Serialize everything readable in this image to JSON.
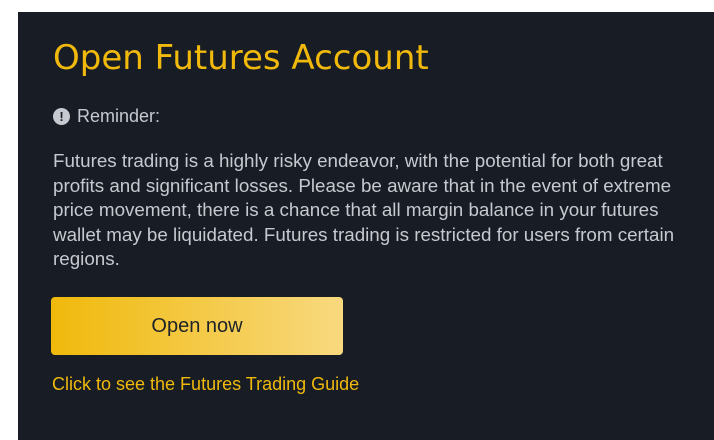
{
  "card": {
    "title": "Open Futures Account",
    "reminder_icon": "exclamation-circle-icon",
    "reminder_icon_glyph": "!",
    "reminder_label": "Reminder:",
    "body": "Futures trading is a highly risky endeavor, with the potential for both great profits and significant losses. Please be aware that in the event of extreme price movement, there is a chance that all margin balance in your futures wallet may be liquidated. Futures trading is restricted for users from certain regions.",
    "open_button_label": "Open now",
    "guide_link_label": "Click to see the Futures Trading Guide"
  },
  "colors": {
    "background": "#181c24",
    "accent": "#f0b90b",
    "text": "#c6c9cf"
  }
}
